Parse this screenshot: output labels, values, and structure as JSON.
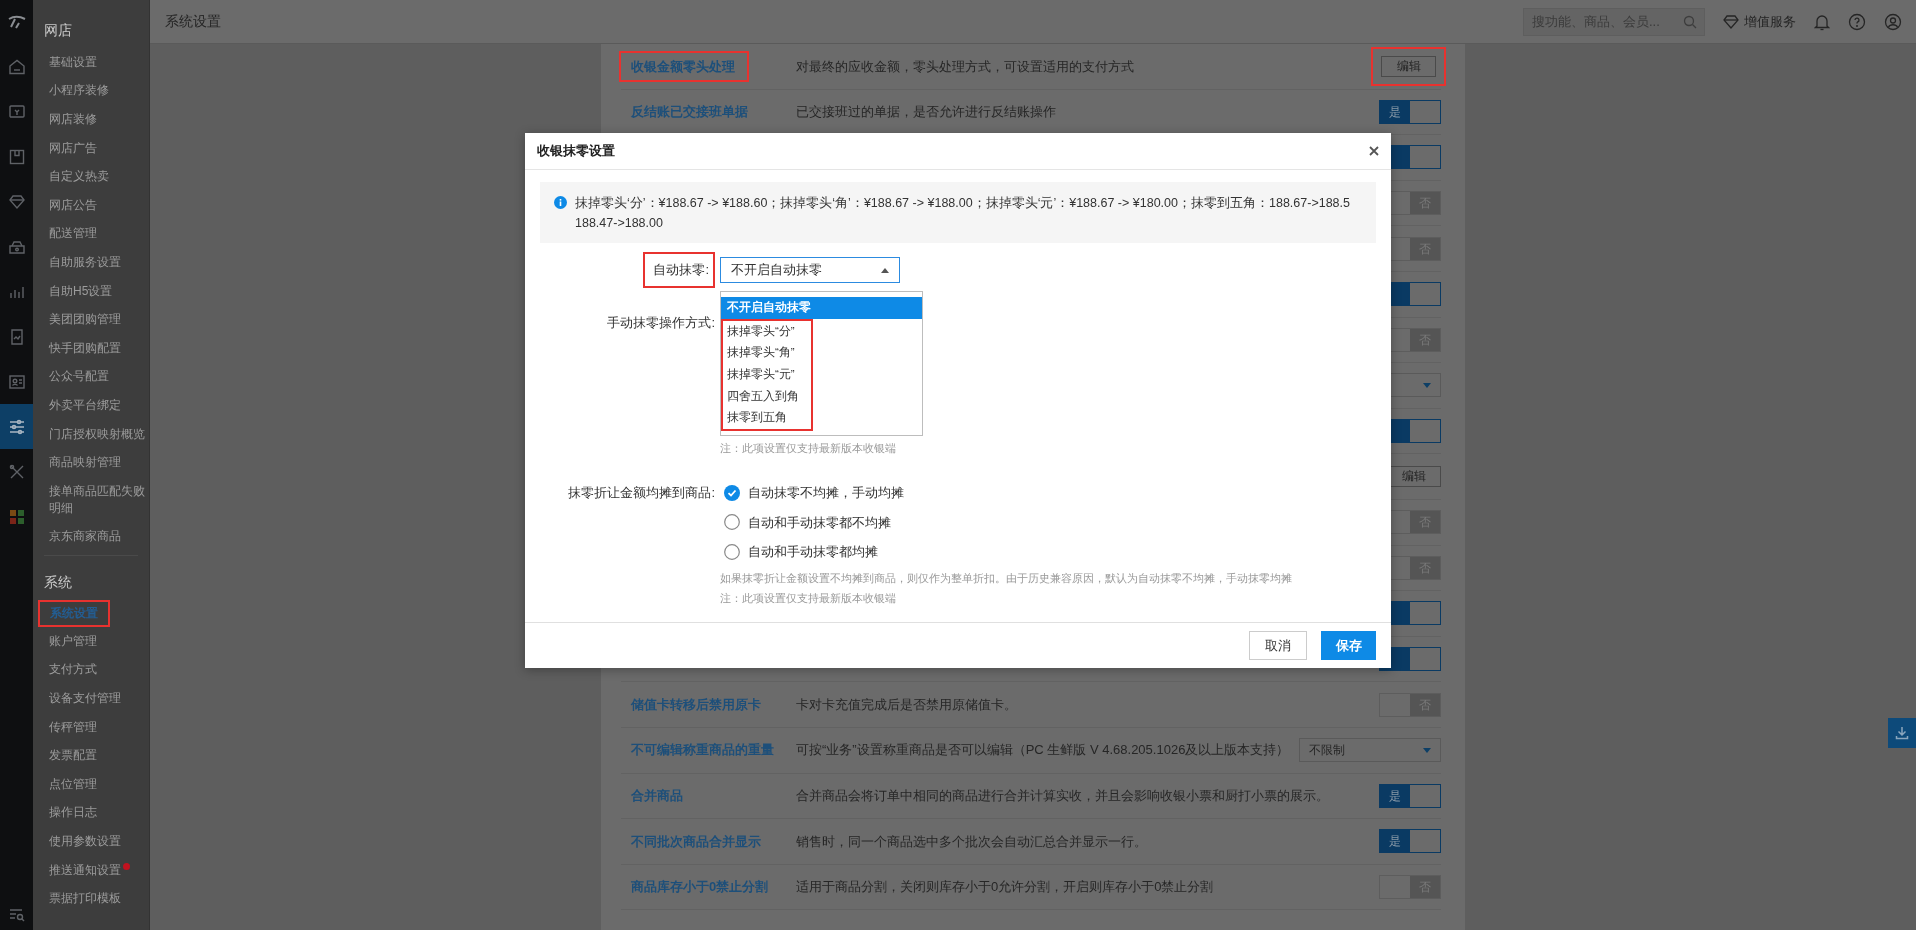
{
  "header": {
    "title": "系统设置",
    "search_placeholder": "搜功能、商品、会员...",
    "service_label": "增值服务"
  },
  "sidebar": {
    "rail": [
      {
        "selected": false
      },
      {
        "selected": false
      },
      {
        "selected": false
      },
      {
        "selected": false
      },
      {
        "selected": false
      },
      {
        "selected": false
      },
      {
        "selected": false
      },
      {
        "selected": false
      },
      {
        "selected": true
      },
      {
        "selected": false
      },
      {
        "selected": false
      }
    ],
    "groups": [
      {
        "title": "网店",
        "items": [
          {
            "label": "基础设置",
            "selected": false,
            "marked": false,
            "dot": false
          },
          {
            "label": "小程序装修",
            "selected": false,
            "marked": false,
            "dot": false
          },
          {
            "label": "网店装修",
            "selected": false,
            "marked": false,
            "dot": false
          },
          {
            "label": "网店广告",
            "selected": false,
            "marked": false,
            "dot": false
          },
          {
            "label": "自定义热卖",
            "selected": false,
            "marked": false,
            "dot": false
          },
          {
            "label": "网店公告",
            "selected": false,
            "marked": false,
            "dot": false
          },
          {
            "label": "配送管理",
            "selected": false,
            "marked": false,
            "dot": false
          },
          {
            "label": "自助服务设置",
            "selected": false,
            "marked": false,
            "dot": false
          },
          {
            "label": "自助H5设置",
            "selected": false,
            "marked": false,
            "dot": false
          },
          {
            "label": "美团团购管理",
            "selected": false,
            "marked": false,
            "dot": false
          },
          {
            "label": "快手团购配置",
            "selected": false,
            "marked": false,
            "dot": false
          },
          {
            "label": "公众号配置",
            "selected": false,
            "marked": false,
            "dot": false
          },
          {
            "label": "外卖平台绑定",
            "selected": false,
            "marked": false,
            "dot": false
          },
          {
            "label": "门店授权映射概览",
            "selected": false,
            "marked": false,
            "dot": false
          },
          {
            "label": "商品映射管理",
            "selected": false,
            "marked": false,
            "dot": false
          },
          {
            "label": "接单商品匹配失败明细",
            "selected": false,
            "marked": false,
            "dot": false
          },
          {
            "label": "京东商家商品",
            "selected": false,
            "marked": false,
            "dot": false
          }
        ]
      },
      {
        "title": "系统",
        "items": [
          {
            "label": "系统设置",
            "selected": true,
            "marked": true,
            "dot": false
          },
          {
            "label": "账户管理",
            "selected": false,
            "marked": false,
            "dot": false
          },
          {
            "label": "支付方式",
            "selected": false,
            "marked": false,
            "dot": false
          },
          {
            "label": "设备支付管理",
            "selected": false,
            "marked": false,
            "dot": false
          },
          {
            "label": "传秤管理",
            "selected": false,
            "marked": false,
            "dot": false
          },
          {
            "label": "发票配置",
            "selected": false,
            "marked": false,
            "dot": false
          },
          {
            "label": "点位管理",
            "selected": false,
            "marked": false,
            "dot": false
          },
          {
            "label": "操作日志",
            "selected": false,
            "marked": false,
            "dot": false
          },
          {
            "label": "使用参数设置",
            "selected": false,
            "marked": false,
            "dot": false
          },
          {
            "label": "推送通知设置",
            "selected": false,
            "marked": false,
            "dot": true
          },
          {
            "label": "票据打印模板",
            "selected": false,
            "marked": false,
            "dot": false
          }
        ]
      }
    ]
  },
  "settings": [
    {
      "title": "收银金额零头处理",
      "title_marked": true,
      "description": "对最终的应收金额，零头处理方式，可设置适用的支付方式",
      "control": {
        "kind": "button",
        "label": "编辑",
        "marked": true
      }
    },
    {
      "title": "反结账已交接班单据",
      "title_marked": false,
      "description": "已交接班过的单据，是否允许进行反结账操作",
      "control": {
        "kind": "toggle",
        "on": true,
        "label": "是"
      }
    },
    {
      "control": {
        "kind": "toggle",
        "on": true
      }
    },
    {
      "control": {
        "kind": "toggle",
        "on": false,
        "label": "否"
      }
    },
    {
      "control": {
        "kind": "toggle",
        "on": false,
        "label": "否"
      }
    },
    {
      "control": {
        "kind": "toggle",
        "on": true
      }
    },
    {
      "control": {
        "kind": "toggle",
        "on": false,
        "label": "否"
      }
    },
    {
      "control": {
        "kind": "select"
      }
    },
    {
      "control": {
        "kind": "toggle",
        "on": true
      }
    },
    {
      "control": {
        "kind": "button",
        "label": "编辑",
        "marked": false
      }
    },
    {
      "control": {
        "kind": "toggle",
        "on": false,
        "label": "否"
      }
    },
    {
      "control": {
        "kind": "toggle",
        "on": false,
        "label": "否"
      }
    },
    {
      "control": {
        "kind": "toggle",
        "on": true
      }
    },
    {
      "control": {
        "kind": "toggle",
        "on": true
      }
    },
    {
      "title": "储值卡转移后禁用原卡",
      "title_marked": false,
      "description": "卡对卡充值完成后是否禁用原储值卡。",
      "control": {
        "kind": "toggle",
        "on": false,
        "label": "否"
      }
    },
    {
      "title": "不可编辑称重商品的重量",
      "title_marked": false,
      "description": "可按“业务”设置称重商品是否可以编辑（PC 生鲜版 V 4.68.205.1026及以上版本支持）",
      "control": {
        "kind": "select",
        "value": "不限制"
      }
    },
    {
      "title": "合并商品",
      "title_marked": false,
      "description": "合并商品会将订单中相同的商品进行合并计算实收，并且会影响收银小票和厨打小票的展示。",
      "control": {
        "kind": "toggle",
        "on": true,
        "label": "是"
      }
    },
    {
      "title": "不同批次商品合并显示",
      "title_marked": false,
      "description": "销售时，同一个商品选中多个批次会自动汇总合并显示一行。",
      "control": {
        "kind": "toggle",
        "on": true,
        "label": "是"
      }
    },
    {
      "title": "商品库存小于0禁止分割",
      "title_marked": false,
      "description": "适用于商品分割，关闭则库存小于0允许分割，开启则库存小于0禁止分割",
      "control": {
        "kind": "toggle",
        "on": false,
        "label": "否"
      }
    }
  ],
  "dialog": {
    "title": "收银抹零设置",
    "info": "抹掉零头‘分’：¥188.67 -> ¥188.60；抹掉零头‘角’：¥188.67 -> ¥188.00；抹掉零头‘元’：¥188.67 -> ¥180.00；抹零到五角：188.67->188.5\n188.47->188.00",
    "fields": [
      {
        "kind": "select",
        "label": "自动抹零:",
        "label_marked": true,
        "value": "不开启自动抹零",
        "expanded": true,
        "options": [
          {
            "label": "不开启自动抹零",
            "selected": true,
            "marked": false
          },
          {
            "label": "抹掉零头“分”",
            "selected": false,
            "marked": true
          },
          {
            "label": "抹掉零头“角”",
            "selected": false,
            "marked": true
          },
          {
            "label": "抹掉零头“元”",
            "selected": false,
            "marked": true
          },
          {
            "label": "四舍五入到角",
            "selected": false,
            "marked": true
          },
          {
            "label": "抹零到五角",
            "selected": false,
            "marked": true
          }
        ]
      },
      {
        "kind": "hidden",
        "label": "手动抹零操作方式:",
        "label_marked": false,
        "notes": [
          "注：此项设置仅支持最新版本收银端"
        ]
      },
      {
        "kind": "radio",
        "label": "抹零折让金额均摊到商品:",
        "label_marked": false,
        "options": [
          {
            "label": "自动抹零不均摊，手动均摊",
            "selected": true
          },
          {
            "label": "自动和手动抹零都不均摊",
            "selected": false
          },
          {
            "label": "自动和手动抹零都均摊",
            "selected": false
          }
        ],
        "notes": [
          "如果抹零折让金额设置不均摊到商品，则仅作为整单折扣。由于历史兼容原因，默认为自动抹零不均摊，手动抹零均摊",
          "注：此项设置仅支持最新版本收银端"
        ]
      }
    ],
    "buttons": [
      {
        "label": "取消",
        "kind": "secondary"
      },
      {
        "label": "保存",
        "kind": "primary"
      }
    ]
  }
}
